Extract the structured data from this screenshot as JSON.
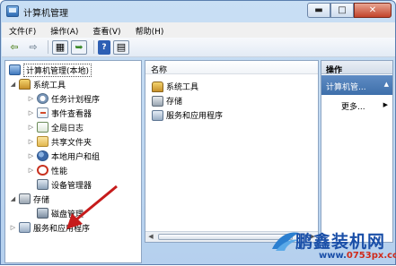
{
  "window": {
    "title": "计算机管理",
    "min": "▬",
    "max": "□",
    "close": "✕"
  },
  "menu": [
    "文件(F)",
    "操作(A)",
    "查看(V)",
    "帮助(H)"
  ],
  "toolbar": {
    "help_label": "?"
  },
  "tree": {
    "items": [
      {
        "label": "计算机管理(本地)",
        "icon": "computer-icon"
      },
      {
        "label": "系统工具",
        "icon": "tools-icon"
      },
      {
        "label": "任务计划程序",
        "icon": "clock-icon"
      },
      {
        "label": "事件查看器",
        "icon": "event-viewer-icon"
      },
      {
        "label": "全局日志",
        "icon": "performance-icon"
      },
      {
        "label": "共享文件夹",
        "icon": "folder-icon"
      },
      {
        "label": "本地用户和组",
        "icon": "users-icon"
      },
      {
        "label": "性能",
        "icon": "performance-block-icon"
      },
      {
        "label": "设备管理器",
        "icon": "device-manager-icon"
      },
      {
        "label": "存储",
        "icon": "storage-icon"
      },
      {
        "label": "磁盘管理",
        "icon": "disk-icon"
      },
      {
        "label": "服务和应用程序",
        "icon": "services-icon"
      }
    ]
  },
  "center": {
    "column_header": "名称",
    "rows": [
      {
        "label": "系统工具",
        "icon": "tools-icon"
      },
      {
        "label": "存储",
        "icon": "storage-icon"
      },
      {
        "label": "服务和应用程序",
        "icon": "services-icon"
      }
    ]
  },
  "actions": {
    "header": "操作",
    "selected": "计算机管...",
    "more": "更多..."
  },
  "watermark": {
    "brand": "鹏鑫装机网",
    "url_prefix": "www.",
    "url_main": "0753px.com"
  }
}
